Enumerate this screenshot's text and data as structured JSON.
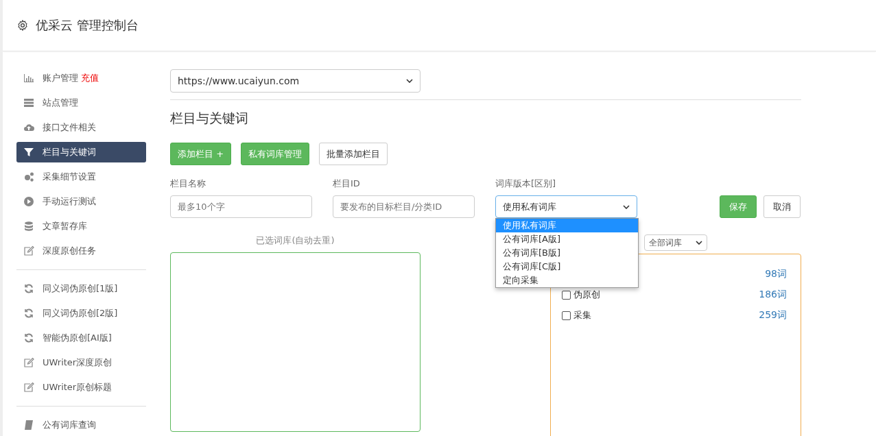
{
  "header": {
    "title": "优采云 管理控制台"
  },
  "sidebar": {
    "groups": [
      [
        {
          "label": "账户管理",
          "badge": "充值",
          "selected": false
        },
        {
          "label": "站点管理",
          "selected": false
        },
        {
          "label": "接口文件相关",
          "selected": false
        },
        {
          "label": "栏目与关键词",
          "selected": true
        },
        {
          "label": "采集细节设置",
          "selected": false
        },
        {
          "label": "手动运行测试",
          "selected": false
        },
        {
          "label": "文章暂存库",
          "selected": false
        },
        {
          "label": "深度原创任务",
          "selected": false
        }
      ],
      [
        {
          "label": "同义词伪原创[1版]",
          "selected": false
        },
        {
          "label": "同义词伪原创[2版]",
          "selected": false
        },
        {
          "label": "智能伪原创[AI版]",
          "selected": false
        },
        {
          "label": "UWriter深度原创",
          "selected": false
        },
        {
          "label": "UWriter原创标题",
          "selected": false
        }
      ],
      [
        {
          "label": "公有词库查询",
          "selected": false
        }
      ]
    ]
  },
  "site_select": {
    "value": "https://www.ucaiyun.com"
  },
  "section_title": "栏目与关键词",
  "buttons": [
    {
      "label": "添加栏目 +",
      "kind": "primary"
    },
    {
      "label": "私有词库管理",
      "kind": "primary"
    },
    {
      "label": "批量添加栏目",
      "kind": "default"
    }
  ],
  "form": {
    "name": {
      "label": "栏目名称",
      "placeholder": "最多10个字"
    },
    "id": {
      "label": "栏目ID",
      "placeholder": "要发布的目标栏目/分类ID"
    },
    "library": {
      "label": "词库版本[区别]",
      "value": "使用私有词库",
      "expanded": true,
      "options": [
        {
          "label": "使用私有词库",
          "selected": true
        },
        {
          "label": "公有词库[A版]",
          "selected": false
        },
        {
          "label": "公有词库[B版]",
          "selected": false
        },
        {
          "label": "公有词库[C版]",
          "selected": false
        },
        {
          "label": "定向采集",
          "selected": false
        }
      ]
    },
    "save": "保存",
    "cancel": "取消"
  },
  "selected_box": {
    "label": "已选词库(自动去重)"
  },
  "filter_select": {
    "value": "全部词库"
  },
  "library_list": [
    {
      "count": "98词"
    },
    {
      "name": "伪原创",
      "checked": false,
      "count": "186词"
    },
    {
      "name": "采集",
      "checked": false,
      "count": "259词"
    }
  ]
}
